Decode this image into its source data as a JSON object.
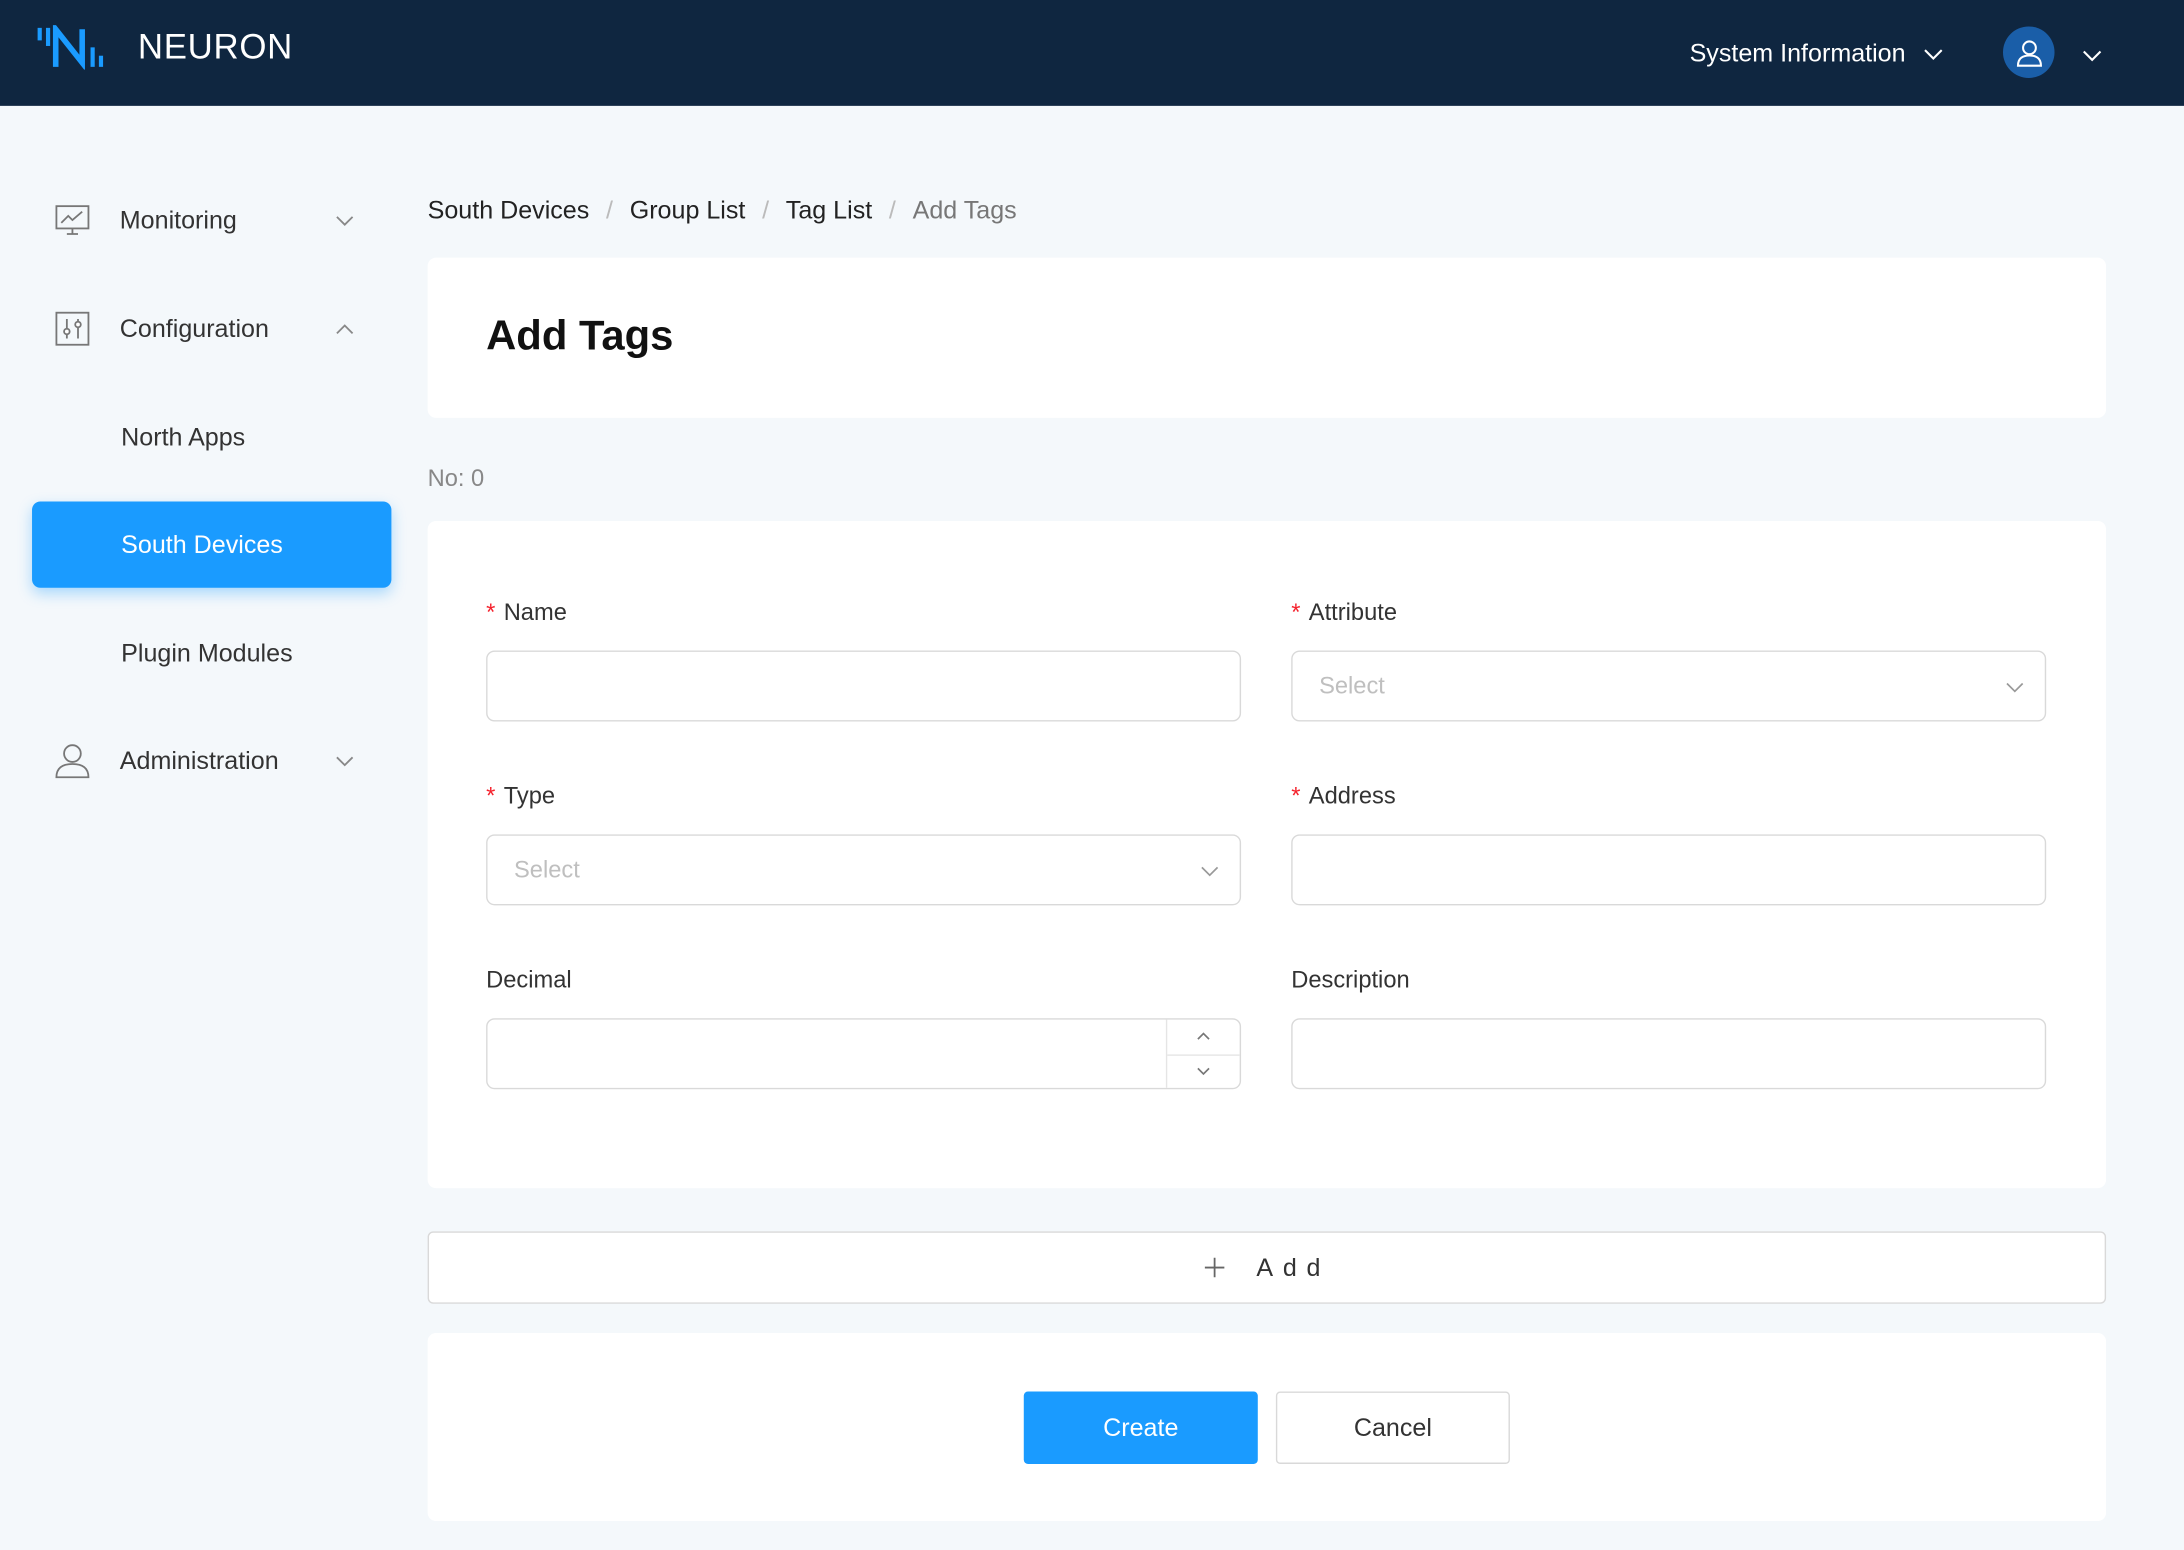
{
  "app": {
    "name": "NEURON"
  },
  "header": {
    "system_info": "System Information"
  },
  "sidebar": {
    "monitoring": "Monitoring",
    "configuration": "Configuration",
    "north_apps": "North Apps",
    "south_devices": "South Devices",
    "plugin_modules": "Plugin Modules",
    "administration": "Administration"
  },
  "breadcrumb": [
    "South Devices",
    "Group List",
    "Tag List",
    "Add Tags"
  ],
  "page": {
    "title": "Add Tags",
    "count_label": "No: 0"
  },
  "form": {
    "required_mark": "*",
    "name": {
      "label": "Name",
      "value": ""
    },
    "attribute": {
      "label": "Attribute",
      "placeholder": "Select"
    },
    "type": {
      "label": "Type",
      "placeholder": "Select"
    },
    "address": {
      "label": "Address",
      "value": ""
    },
    "decimal": {
      "label": "Decimal",
      "value": ""
    },
    "description": {
      "label": "Description",
      "value": ""
    }
  },
  "actions": {
    "add": "Add",
    "create": "Create",
    "cancel": "Cancel"
  },
  "colors": {
    "header_bg": "#0f2640",
    "accent": "#1a9bff",
    "required": "#f5222d"
  }
}
